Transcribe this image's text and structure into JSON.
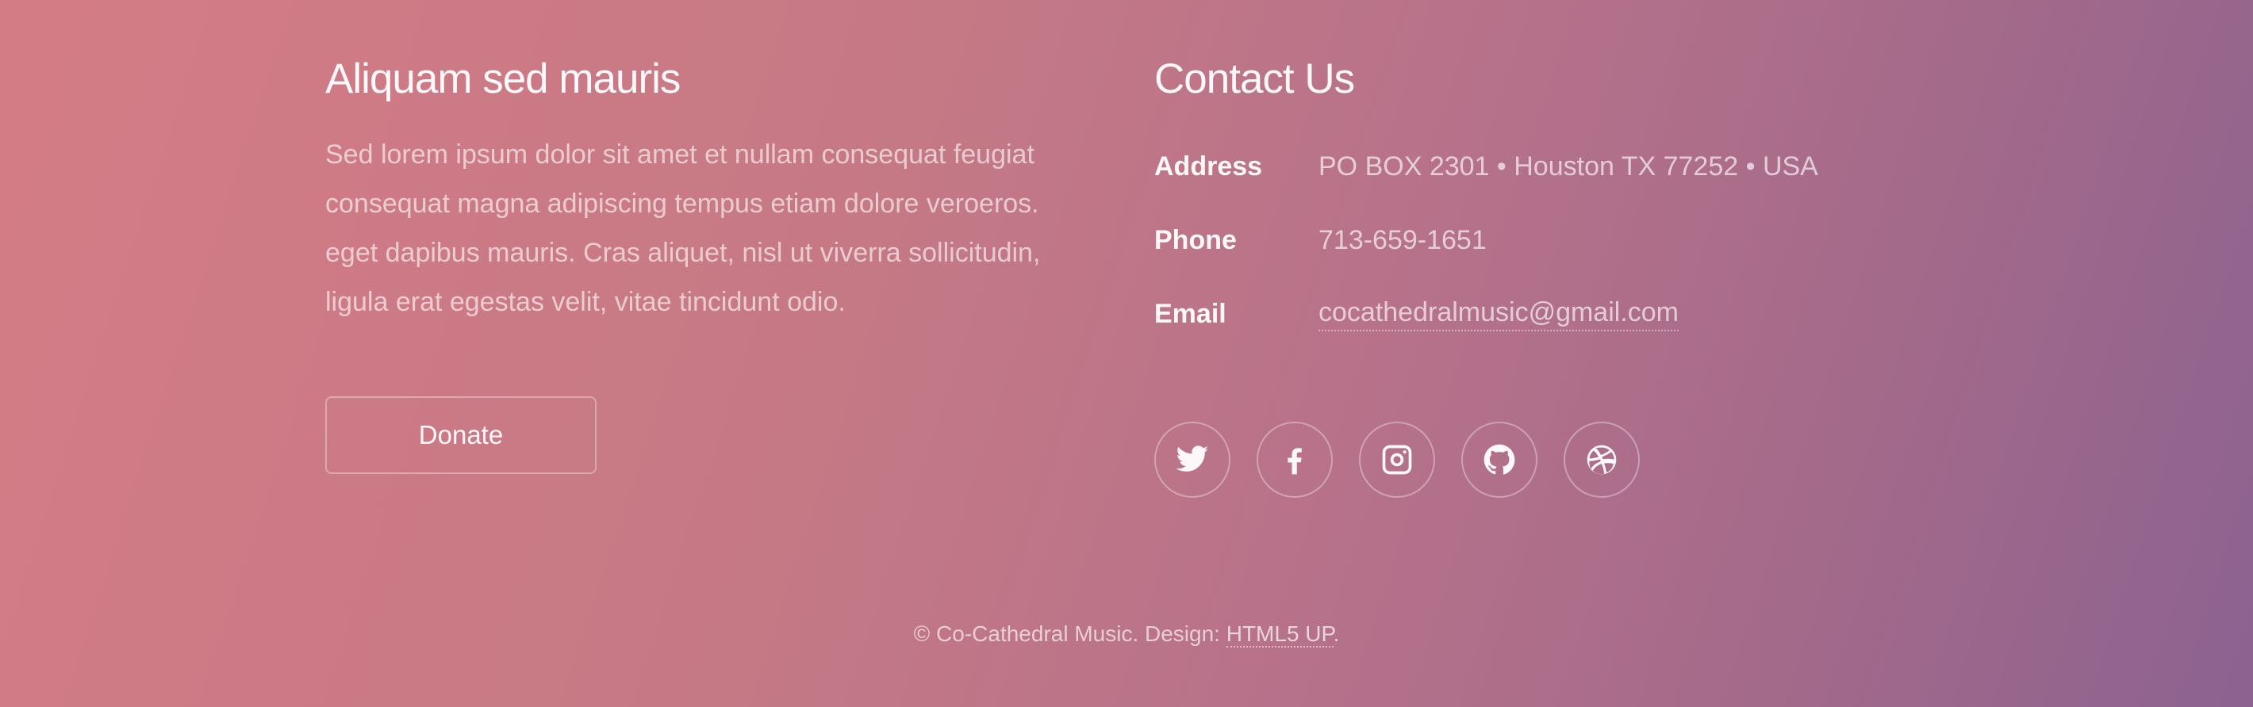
{
  "left": {
    "heading": "Aliquam sed mauris",
    "paragraph": "Sed lorem ipsum dolor sit amet et nullam consequat feugiat consequat magna adipiscing tempus etiam dolore veroeros. eget dapibus mauris. Cras aliquet, nisl ut viverra sollicitudin, ligula erat egestas velit, vitae tincidunt odio.",
    "donate_label": "Donate"
  },
  "contact": {
    "heading": "Contact Us",
    "rows": [
      {
        "label": "Address",
        "value": "PO BOX 2301 • Houston TX 77252 • USA"
      },
      {
        "label": "Phone",
        "value": "713-659-1651"
      },
      {
        "label": "Email",
        "value": "cocathedralmusic@gmail.com"
      }
    ]
  },
  "social_icons": [
    "twitter-icon",
    "facebook-icon",
    "instagram-icon",
    "github-icon",
    "dribbble-icon"
  ],
  "footer": {
    "copyright_prefix": "© Co-Cathedral Music. Design: ",
    "design_link": "HTML5 UP",
    "copyright_suffix": "."
  },
  "colors": {
    "gradient_start": "#d47c86",
    "gradient_end": "#8c6290"
  }
}
